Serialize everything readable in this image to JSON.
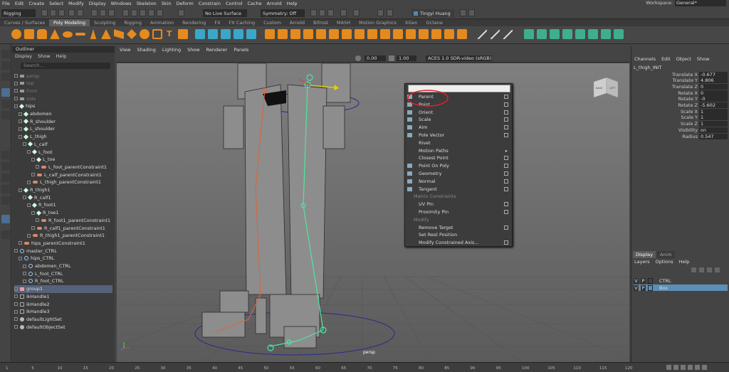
{
  "menubar": {
    "items": [
      "File",
      "Edit",
      "Create",
      "Select",
      "Modify",
      "Display",
      "Windows",
      "Skeleton",
      "Skin",
      "Deform",
      "Constrain",
      "Control",
      "Cache",
      "Arnold",
      "Help"
    ],
    "workspace_label": "Workspace:",
    "workspace_value": "General*"
  },
  "status_line": {
    "mode": "Rigging",
    "live_surface": "No Live Surface",
    "symmetry": "Symmetry: Off",
    "user": "Tingyi Huang"
  },
  "shelf_tabs": [
    {
      "label": "Curves / Surfaces",
      "active": false
    },
    {
      "label": "Poly Modeling",
      "active": true
    },
    {
      "label": "Sculpting",
      "active": false
    },
    {
      "label": "Rigging",
      "active": false
    },
    {
      "label": "Animation",
      "active": false
    },
    {
      "label": "Rendering",
      "active": false
    },
    {
      "label": "FX",
      "active": false
    },
    {
      "label": "FX Caching",
      "active": false
    },
    {
      "label": "Custom",
      "active": false
    },
    {
      "label": "Arnold",
      "active": false
    },
    {
      "label": "Bifrost",
      "active": false
    },
    {
      "label": "MASH",
      "active": false
    },
    {
      "label": "Motion Graphics",
      "active": false
    },
    {
      "label": "XGen",
      "active": false
    },
    {
      "label": "Octane",
      "active": false
    }
  ],
  "outliner": {
    "title": "Outliner",
    "menu": [
      "Display",
      "Show",
      "Help"
    ],
    "search_placeholder": "Search...",
    "items": [
      {
        "label": "persp",
        "type": "camera",
        "depth": 0,
        "dim": true
      },
      {
        "label": "top",
        "type": "camera",
        "depth": 0,
        "dim": true
      },
      {
        "label": "front",
        "type": "camera",
        "depth": 0,
        "dim": true
      },
      {
        "label": "side",
        "type": "camera",
        "depth": 0,
        "dim": true
      },
      {
        "label": "hips",
        "type": "joint",
        "depth": 0
      },
      {
        "label": "abdomen",
        "type": "joint",
        "depth": 1
      },
      {
        "label": "R_shoulder",
        "type": "joint",
        "depth": 1
      },
      {
        "label": "L_shoulder",
        "type": "joint",
        "depth": 1
      },
      {
        "label": "L_thigh",
        "type": "joint",
        "depth": 1
      },
      {
        "label": "L_calf",
        "type": "joint",
        "depth": 2
      },
      {
        "label": "L_foot",
        "type": "joint",
        "depth": 3
      },
      {
        "label": "L_toe",
        "type": "joint",
        "depth": 4
      },
      {
        "label": "L_foot_parentConstraint1",
        "type": "constraint",
        "depth": 5
      },
      {
        "label": "L_calf_parentConstraint1",
        "type": "constraint",
        "depth": 4
      },
      {
        "label": "L_thigh_parentConstraint1",
        "type": "constraint",
        "depth": 3
      },
      {
        "label": "R_thigh1",
        "type": "joint",
        "depth": 1
      },
      {
        "label": "R_calf1",
        "type": "joint",
        "depth": 2
      },
      {
        "label": "R_foot1",
        "type": "joint",
        "depth": 3
      },
      {
        "label": "R_toe1",
        "type": "joint",
        "depth": 4
      },
      {
        "label": "R_foot1_parentConstraint1",
        "type": "constraint",
        "depth": 5
      },
      {
        "label": "R_calf1_parentConstraint1",
        "type": "constraint",
        "depth": 4
      },
      {
        "label": "R_thigh1_parentConstraint1",
        "type": "constraint",
        "depth": 3
      },
      {
        "label": "hips_parentConstraint1",
        "type": "constraint",
        "depth": 1
      },
      {
        "label": "master_CTRL",
        "type": "transform",
        "depth": 0
      },
      {
        "label": "hips_CTRL",
        "type": "transform",
        "depth": 1
      },
      {
        "label": "abdomen_CTRL",
        "type": "transform",
        "depth": 2
      },
      {
        "label": "L_foot_CTRL",
        "type": "transform",
        "depth": 2
      },
      {
        "label": "R_foot_CTRL",
        "type": "transform",
        "depth": 2
      },
      {
        "label": "group1",
        "type": "group",
        "depth": 0,
        "highlight": true
      },
      {
        "label": "ikHandle1",
        "type": "ik",
        "depth": 0
      },
      {
        "label": "ikHandle2",
        "type": "ik",
        "depth": 0
      },
      {
        "label": "ikHandle3",
        "type": "ik",
        "depth": 0
      },
      {
        "label": "defaultLightSet",
        "type": "set",
        "depth": 0
      },
      {
        "label": "defaultObjectSet",
        "type": "set",
        "depth": 0
      }
    ]
  },
  "viewport": {
    "menu": [
      "View",
      "Shading",
      "Lighting",
      "Show",
      "Renderer",
      "Panels"
    ],
    "exposure": "0.00",
    "gamma": "1.00",
    "color_space": "ACES 1.0 SDR-video (sRGB)",
    "camera_label": "persp",
    "viewcube_left": "BACK",
    "viewcube_right": "LEFT"
  },
  "context_menu": {
    "items": [
      {
        "label": "Parent",
        "box": true,
        "icon": true,
        "annotated": true
      },
      {
        "label": "Point",
        "box": true,
        "icon": true
      },
      {
        "label": "Orient",
        "box": true,
        "icon": true
      },
      {
        "label": "Scale",
        "box": true,
        "icon": true
      },
      {
        "label": "Aim",
        "box": true,
        "icon": true
      },
      {
        "label": "Pole Vector",
        "box": true,
        "icon": true
      },
      {
        "label": "Rivet",
        "box": false,
        "icon": false
      },
      {
        "label": "Motion Paths",
        "box": false,
        "icon": false,
        "submenu": true
      },
      {
        "label": "Closest Point",
        "box": true,
        "icon": false
      },
      {
        "label": "Point On Poly",
        "box": true,
        "icon": true
      },
      {
        "label": "Geometry",
        "box": true,
        "icon": true
      },
      {
        "label": "Normal",
        "box": true,
        "icon": true
      },
      {
        "label": "Tangent",
        "box": true,
        "icon": true
      },
      {
        "label": "Matrix Constraints",
        "group": true
      },
      {
        "label": "UV Pin",
        "box": true,
        "icon": false
      },
      {
        "label": "Proximity Pin",
        "box": true,
        "icon": false
      },
      {
        "label": "Modify",
        "group": true
      },
      {
        "label": "Remove Target",
        "box": true,
        "icon": false
      },
      {
        "label": "Set Rest Position",
        "box": false,
        "icon": false
      },
      {
        "label": "Modify Constrained Axis...",
        "box": true,
        "icon": false
      }
    ]
  },
  "channel_box": {
    "menu": [
      "Channels",
      "Edit",
      "Object",
      "Show"
    ],
    "node_name": "L_thigh_INIT",
    "attributes": [
      {
        "label": "Translate X",
        "value": "-0.677"
      },
      {
        "label": "Translate Y",
        "value": "4.806"
      },
      {
        "label": "Translate Z",
        "value": "0"
      },
      {
        "label": "Rotate X",
        "value": "0"
      },
      {
        "label": "Rotate Y",
        "value": "-0"
      },
      {
        "label": "Rotate Z",
        "value": "-5.602"
      },
      {
        "label": "Scale X",
        "value": "1"
      },
      {
        "label": "Scale Y",
        "value": "1"
      },
      {
        "label": "Scale Z",
        "value": "1"
      },
      {
        "label": "Visibility",
        "value": "on"
      },
      {
        "label": "Radius",
        "value": "0.547"
      }
    ]
  },
  "layer_panel": {
    "tabs": [
      {
        "label": "Display",
        "active": true
      },
      {
        "label": "Anim",
        "active": false
      }
    ],
    "menu": [
      "Layers",
      "Options",
      "Help"
    ],
    "layers": [
      {
        "v": "V",
        "p": "P",
        "name": "CTRL",
        "color": "#444444",
        "selected": false
      },
      {
        "v": "V",
        "p": "P",
        "name": "Box",
        "color": "#5c8fb5",
        "selected": true
      }
    ]
  },
  "timeline": {
    "ticks": [
      "1",
      "5",
      "10",
      "15",
      "20",
      "25",
      "30",
      "35",
      "40",
      "45",
      "50",
      "55",
      "60",
      "65",
      "70",
      "75",
      "80",
      "85",
      "90",
      "95",
      "100",
      "105",
      "110",
      "115",
      "120"
    ]
  },
  "colors": {
    "annotation_circle": "#e0202a",
    "joint_green": "#4ee6a0",
    "joint_orange": "#d9663a",
    "curve_blue": "#1f1f8f"
  }
}
